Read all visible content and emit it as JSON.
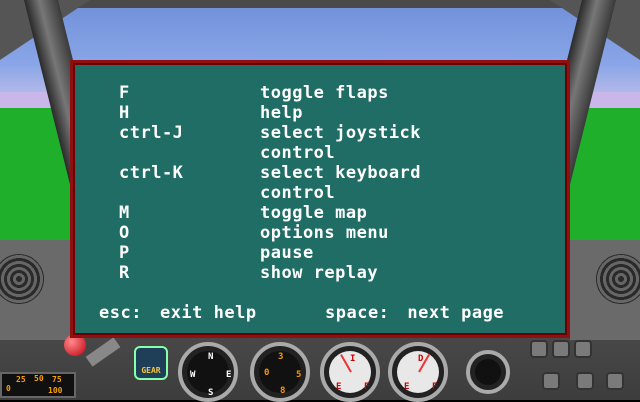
{
  "help": {
    "rows": [
      {
        "key": "F",
        "desc": "toggle flaps"
      },
      {
        "key": "H",
        "desc": "help"
      },
      {
        "key": "ctrl-J",
        "desc": "select joystick"
      },
      {
        "key": "",
        "desc": "control"
      },
      {
        "key": "ctrl-K",
        "desc": "select keyboard"
      },
      {
        "key": "",
        "desc": "control"
      },
      {
        "key": "M",
        "desc": "toggle map"
      },
      {
        "key": "O",
        "desc": "options menu"
      },
      {
        "key": "P",
        "desc": "pause"
      },
      {
        "key": "R",
        "desc": "show replay"
      }
    ],
    "footer": {
      "esc_key": "esc:",
      "esc_action": "exit help",
      "space_key": "space:",
      "space_action": "next page"
    }
  },
  "cockpit": {
    "gear_label": "GEAR",
    "compass": {
      "n": "N",
      "s": "S",
      "e": "E",
      "w": "W"
    },
    "altimeter_marks": [
      "0",
      "3",
      "5",
      "8"
    ],
    "gauge_left_label": "I",
    "gauge_left_e": "E",
    "gauge_left_f": "F",
    "gauge_right_label": "D",
    "gauge_right_e": "E",
    "gauge_right_f": "F",
    "speed_marks": [
      "0",
      "25",
      "50",
      "75",
      "100"
    ],
    "colors": {
      "panel": "#1f6d64",
      "panel_border": "#8f1010",
      "ground": "#1faf2a",
      "sky": "#8aa6e8"
    }
  }
}
